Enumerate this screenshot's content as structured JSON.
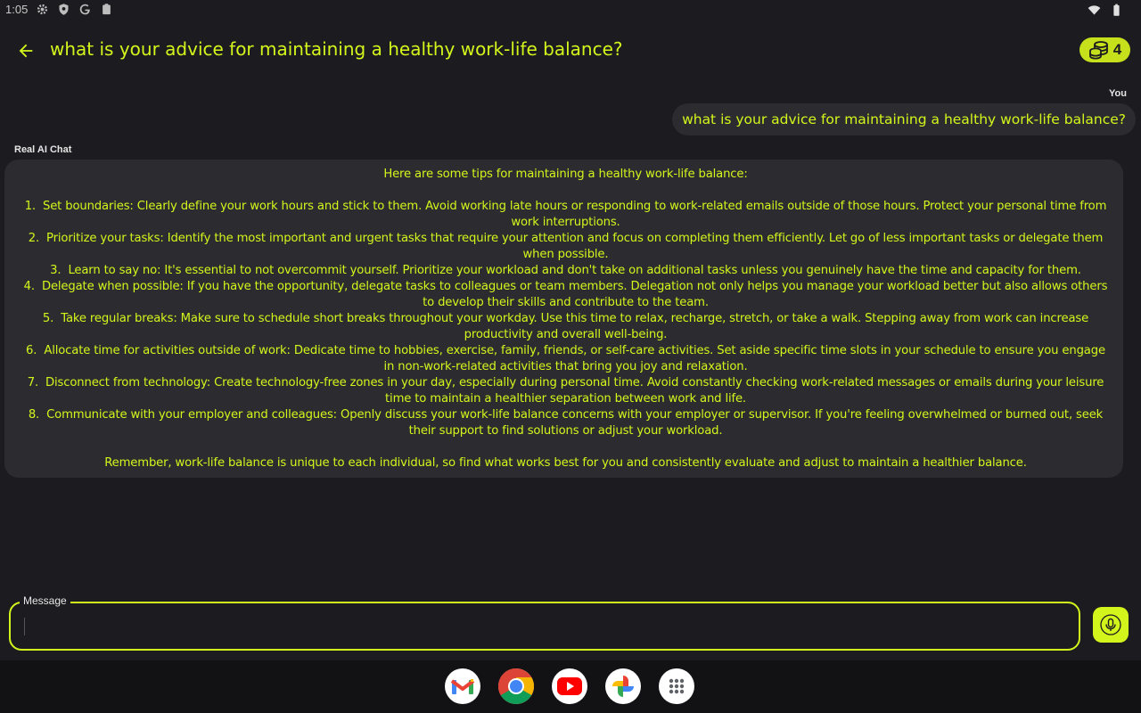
{
  "status_bar": {
    "time": "1:05",
    "icons": [
      "settings-icon",
      "shield-icon",
      "google-g-icon",
      "clipboard-icon",
      "wifi-icon",
      "battery-icon"
    ]
  },
  "header": {
    "title": "what is your advice for maintaining a healthy work-life balance?",
    "coins": "4"
  },
  "chat": {
    "user_label": "You",
    "user_message": "what is your advice for maintaining a healthy work-life balance?",
    "ai_label": "Real AI Chat",
    "ai_intro": "Here are some tips for maintaining a healthy work-life balance:",
    "tips": [
      {
        "num": "1.",
        "text": "Set boundaries: Clearly define your work hours and stick to them. Avoid working late hours or responding to work-related emails outside of those hours. Protect your personal time from work interruptions."
      },
      {
        "num": "2.",
        "text": "Prioritize your tasks: Identify the most important and urgent tasks that require your attention and focus on completing them efficiently. Let go of less important tasks or delegate them when possible."
      },
      {
        "num": "3.",
        "text": "Learn to say no: It's essential to not overcommit yourself. Prioritize your workload and don't take on additional tasks unless you genuinely have the time and capacity for them."
      },
      {
        "num": "4.",
        "text": "Delegate when possible: If you have the opportunity, delegate tasks to colleagues or team members. Delegation not only helps you manage your workload better but also allows others to develop their skills and contribute to the team."
      },
      {
        "num": "5.",
        "text": "Take regular breaks: Make sure to schedule short breaks throughout your workday. Use this time to relax, recharge, stretch, or take a walk. Stepping away from work can increase productivity and overall well-being."
      },
      {
        "num": "6.",
        "text": "Allocate time for activities outside of work: Dedicate time to hobbies, exercise, family, friends, or self-care activities. Set aside specific time slots in your schedule to ensure you engage in non-work-related activities that bring you joy and relaxation."
      },
      {
        "num": "7.",
        "text": "Disconnect from technology: Create technology-free zones in your day, especially during personal time. Avoid constantly checking work-related messages or emails during your leisure time to maintain a healthier separation between work and life."
      },
      {
        "num": "8.",
        "text": "Communicate with your employer and colleagues: Openly discuss your work-life balance concerns with your employer or supervisor. If you're feeling overwhelmed or burned out, seek their support to find solutions or adjust your workload."
      }
    ],
    "ai_outro": "Remember, work-life balance is unique to each individual, so find what works best for you and consistently evaluate and adjust to maintain a healthier balance."
  },
  "input": {
    "label": "Message",
    "value": ""
  },
  "dock": {
    "apps": [
      "gmail-icon",
      "chrome-icon",
      "youtube-icon",
      "photos-icon",
      "app-drawer-icon"
    ]
  },
  "colors": {
    "accent": "#d4f51c",
    "background": "#1c1b20",
    "bubble": "#2c2c30"
  }
}
